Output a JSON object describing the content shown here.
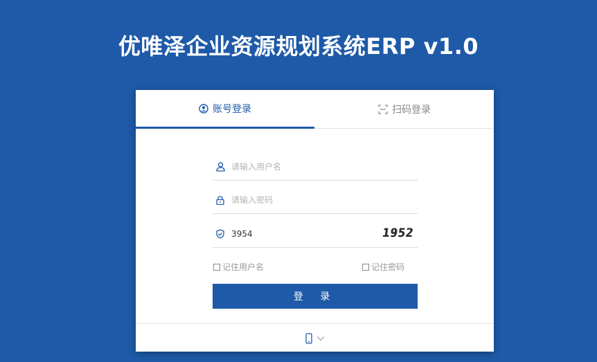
{
  "app": {
    "title": "优唯泽企业资源规划系统ERP v1.0"
  },
  "tabs": [
    {
      "label": "账号登录",
      "icon": "user-circle-icon",
      "active": true
    },
    {
      "label": "扫码登录",
      "icon": "scan-icon",
      "active": false
    }
  ],
  "form": {
    "username": {
      "placeholder": "请输入用户名",
      "value": "",
      "icon": "user-icon"
    },
    "password": {
      "placeholder": "请输入密码",
      "value": "",
      "icon": "lock-icon"
    },
    "captcha": {
      "value": "3954",
      "image_text": "1952",
      "icon": "shield-icon"
    },
    "remember_username": "记住用户名",
    "remember_password": "记住密码",
    "submit_label": "登 录"
  },
  "footer": {
    "icons": [
      "mobile-icon",
      "chevron-down-icon"
    ]
  },
  "colors": {
    "primary": "#1e5aa8",
    "background": "#1e5aa8"
  }
}
